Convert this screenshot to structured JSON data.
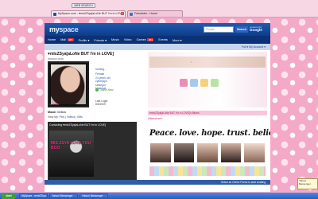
{
  "browser": {
    "web_search_label": "WEB SEARCH",
    "tabs": [
      {
        "label": "MySpace.com - ♥mIsZSya[aLoNe BUT I'm in LOVE]"
      },
      {
        "label": "Friendster - Home"
      }
    ],
    "tab_close_glyph": "x"
  },
  "myspace": {
    "logo_main": "my",
    "logo_sub": "space",
    "search_placeholder": "People",
    "search_label": "Search",
    "powered_by": "powered by",
    "google_label": "Google",
    "nav": [
      {
        "label": "Home",
        "badge": ""
      },
      {
        "label": "Mail",
        "badge": "437"
      },
      {
        "label": "Profile ▾",
        "badge": ""
      },
      {
        "label": "Friends ▾",
        "badge": ""
      },
      {
        "label": "Music",
        "badge": ""
      },
      {
        "label": "Video",
        "badge": ""
      },
      {
        "label": "Games",
        "badge": "284"
      },
      {
        "label": "Events",
        "badge": ""
      },
      {
        "label": "More ▾",
        "badge": ""
      }
    ],
    "subnav_text": "Full ▾   My Account ▾"
  },
  "profile": {
    "display_name": "♥mIsZSya[aLoNe BUT I'm in LOVE]",
    "tagline": "missyue pinky",
    "photo_caption": "mIsZSyA",
    "info_lines": [
      "nothing..",
      "Female",
      "24 years old",
      "cyberjaya",
      "selangor",
      "Malaysia"
    ],
    "online_now": "Online Now!",
    "last_login_label": "Last Login:",
    "last_login_date": "8/6/2009",
    "mood_label": "Mood:",
    "mood_value": "mellow",
    "view_my_label": "View My:",
    "view_my_pics": "Pics",
    "view_my_videos": "Videos",
    "view_my_gifts": "Gifts",
    "contact_title": "Contacting ♥mIsZSya[aLoNe BUT I'm in LOVE]",
    "contact_art_text": "MIS ZSYA LOVE YOU BOO"
  },
  "main": {
    "headline": "♥mIsZSya[aLoNe BUT I'm in LOVE]'s Blurbs",
    "about_label": "About me:",
    "peace_text": "Peace. love. hope. trust. believe.",
    "status_bar_text": "Select an Online Friend to start chatting",
    "side_popup_text": "Yahoo! Messenger"
  },
  "taskbar": {
    "start_label": "start",
    "items": [
      {
        "label": "MySpace - ♥mIsZSya..."
      },
      {
        "label": "Yahoo! Messenger"
      },
      {
        "label": "Yahoo! Messenger"
      }
    ]
  },
  "colors": {
    "page_background": "#f4a9c8",
    "myspace_blue": "#1f5bb3",
    "accent_pink": "#e8559a"
  }
}
